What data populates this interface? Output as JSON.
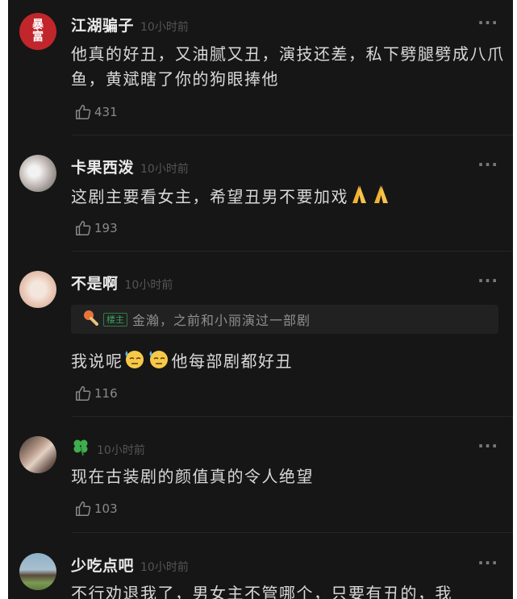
{
  "more_label": "···",
  "comments": [
    {
      "name": "江湖骗子",
      "time": "10小时前",
      "avatar_text": "暴富",
      "text": "他真的好丑，又油腻又丑，演技还差，私下劈腿劈成八爪鱼，黄斌瞎了你的狗眼捧他",
      "likes": "431"
    },
    {
      "name": "卡果西泼",
      "time": "10小时前",
      "text": "这剧主要看女主，希望丑男不要加戏",
      "likes": "193"
    },
    {
      "name": "不是啊",
      "time": "10小时前",
      "quote_badge": "楼主",
      "quote_text": "金瀚，之前和小丽演过一部剧",
      "text_before": "我说呢",
      "text_after": "他每部剧都好丑",
      "likes": "116"
    },
    {
      "name": "",
      "time": "10小时前",
      "text": "现在古装剧的颜值真的令人绝望",
      "likes": "103"
    },
    {
      "name": "少吃点吧",
      "time": "10小时前",
      "text": "不行劝退我了，男女主不管哪个，只要有丑的，我"
    }
  ],
  "colors": {
    "background": "#161616",
    "name": "#eaeaea",
    "time": "#555555",
    "body_text": "#d8d8d8",
    "badge_green": "#3aa35a",
    "avatar_red": "#c0262b"
  }
}
